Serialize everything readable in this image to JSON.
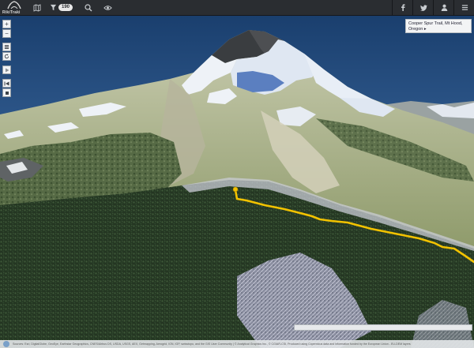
{
  "app": {
    "logo_text": "RikiTraki"
  },
  "topbar": {
    "icons": [
      "logo-icon",
      "map-icon",
      "filter-icon",
      "search-icon",
      "eye-icon",
      "facebook-icon",
      "twitter-icon",
      "user-icon",
      "menu-icon"
    ],
    "filter_count": "190"
  },
  "map_controls": {
    "zoom_in": "+",
    "zoom_out": "−",
    "icons": [
      "layers-icon",
      "refresh-icon",
      "play-icon",
      "rewind-icon",
      "stop-icon"
    ]
  },
  "popup": {
    "title": "Cooper Spur Trail, Mt Hood, Oregon",
    "arrow": "▸"
  },
  "timeline": {
    "progress": 0.0
  },
  "attribution": {
    "text": "Sources: Esri, DigitalGlobe, GeoEye, Earthstar Geographics, CNES/Airbus DS, USDA, USGS, AEX, Getmapping, Aerogrid, IGN, IGP, swisstopo, and the GIS User Community | © Analytical Graphics Inc., © CGIAR-CSI, Produced using Copernicus data and information funded by the European Union - EU-DEM layers"
  },
  "colors": {
    "topbar": "#2a2d31",
    "trail": "#f2c200",
    "sky_top": "#1a3f6e",
    "sky_bottom": "#5d86b8"
  }
}
